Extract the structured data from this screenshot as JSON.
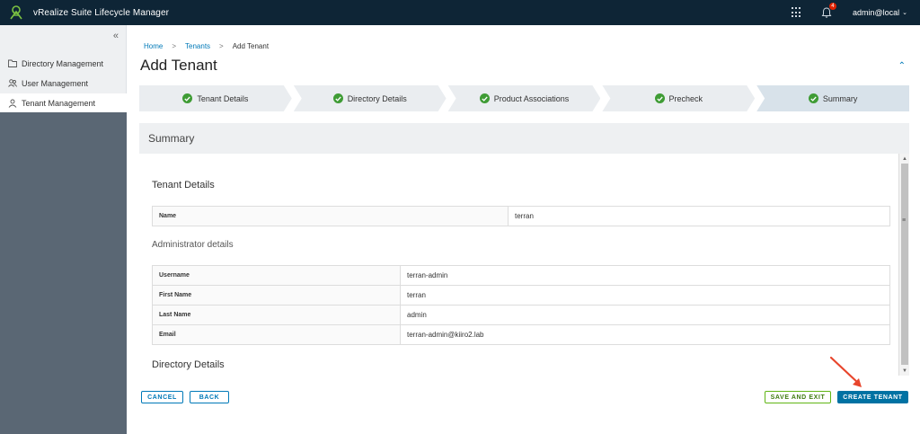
{
  "header": {
    "app_title": "vRealize Suite Lifecycle Manager",
    "notification_count": "4",
    "user": "admin@local"
  },
  "sidebar": {
    "items": [
      {
        "label": "Directory Management",
        "icon": "folder-icon"
      },
      {
        "label": "User Management",
        "icon": "users-icon"
      },
      {
        "label": "Tenant Management",
        "icon": "tenant-icon",
        "active": true
      }
    ]
  },
  "breadcrumb": {
    "home": "Home",
    "tenants": "Tenants",
    "current": "Add Tenant",
    "sep": ">"
  },
  "page_title": "Add Tenant",
  "steps": [
    {
      "label": "Tenant Details",
      "done": true
    },
    {
      "label": "Directory Details",
      "done": true
    },
    {
      "label": "Product Associations",
      "done": true
    },
    {
      "label": "Precheck",
      "done": true
    },
    {
      "label": "Summary",
      "done": true,
      "current": true
    }
  ],
  "summary": {
    "header": "Summary",
    "tenant_details_title": "Tenant Details",
    "tenant_rows": [
      {
        "key": "Name",
        "value": "terran"
      }
    ],
    "admin_title": "Administrator details",
    "admin_rows": [
      {
        "key": "Username",
        "value": "terran-admin"
      },
      {
        "key": "First Name",
        "value": "terran"
      },
      {
        "key": "Last Name",
        "value": "admin"
      },
      {
        "key": "Email",
        "value": "terran-admin@kiiro2.lab"
      }
    ],
    "directory_title": "Directory Details"
  },
  "footer": {
    "cancel": "CANCEL",
    "back": "BACK",
    "save_exit": "SAVE AND EXIT",
    "create": "CREATE TENANT"
  },
  "colors": {
    "header_bg": "#0e2536",
    "accent": "#0079b8",
    "success": "#3f9c35",
    "annotation_arrow": "#e8452c"
  }
}
